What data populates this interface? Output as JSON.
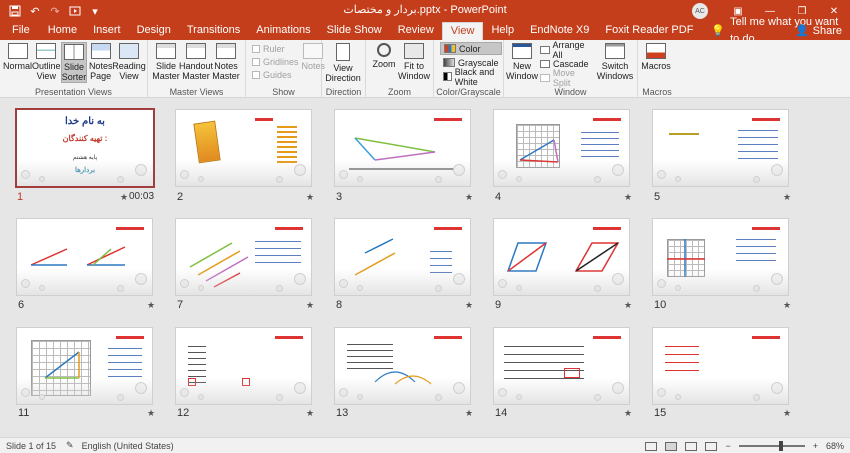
{
  "app": {
    "title": "بردار و مختصات.pptx - PowerPoint",
    "user_initials": "AC",
    "accent": "#c43e1c"
  },
  "qat": {
    "save_icon": "save-icon",
    "undo_icon": "undo-icon",
    "redo_icon": "redo-icon",
    "present_icon": "present-from-start-icon",
    "customize_icon": "customize-icon"
  },
  "window_controls": {
    "ribbon_options": "▣",
    "minimize": "—",
    "restore": "❐",
    "close": "✕"
  },
  "tabs": [
    {
      "label": "File"
    },
    {
      "label": "Home"
    },
    {
      "label": "Insert"
    },
    {
      "label": "Design"
    },
    {
      "label": "Transitions"
    },
    {
      "label": "Animations"
    },
    {
      "label": "Slide Show"
    },
    {
      "label": "Review"
    },
    {
      "label": "View"
    },
    {
      "label": "Help"
    },
    {
      "label": "EndNote X9"
    },
    {
      "label": "Foxit Reader PDF"
    }
  ],
  "active_tab": "View",
  "tellme": {
    "label": "Tell me what you want to do"
  },
  "share": {
    "label": "Share"
  },
  "ribbon": {
    "presentation_views": {
      "label": "Presentation Views",
      "buttons": [
        {
          "l1": "Normal",
          "l2": ""
        },
        {
          "l1": "Outline",
          "l2": "View"
        },
        {
          "l1": "Slide",
          "l2": "Sorter"
        },
        {
          "l1": "Notes",
          "l2": "Page"
        },
        {
          "l1": "Reading",
          "l2": "View"
        }
      ]
    },
    "master_views": {
      "label": "Master Views",
      "buttons": [
        {
          "l1": "Slide",
          "l2": "Master"
        },
        {
          "l1": "Handout",
          "l2": "Master"
        },
        {
          "l1": "Notes",
          "l2": "Master"
        }
      ]
    },
    "show": {
      "label": "Show",
      "items": [
        "Ruler",
        "Gridlines",
        "Guides"
      ],
      "notes": "Notes"
    },
    "direction": {
      "label": "Direction",
      "l1": "View",
      "l2": "Direction"
    },
    "zoom": {
      "label": "Zoom",
      "zoom": "Zoom",
      "fit_l1": "Fit to",
      "fit_l2": "Window"
    },
    "color_grayscale": {
      "label": "Color/Grayscale",
      "items": [
        "Color",
        "Grayscale",
        "Black and White"
      ]
    },
    "window": {
      "label": "Window",
      "new_l1": "New",
      "new_l2": "Window",
      "items": [
        "Arrange All",
        "Cascade",
        "Move Split"
      ],
      "switch_l1": "Switch",
      "switch_l2": "Windows"
    },
    "macros": {
      "label": "Macros",
      "button": "Macros"
    }
  },
  "slides": [
    {
      "num": "1",
      "timing": "00:03"
    },
    {
      "num": "2"
    },
    {
      "num": "3"
    },
    {
      "num": "4"
    },
    {
      "num": "5"
    },
    {
      "num": "6"
    },
    {
      "num": "7"
    },
    {
      "num": "8"
    },
    {
      "num": "9"
    },
    {
      "num": "10"
    },
    {
      "num": "11"
    },
    {
      "num": "12"
    },
    {
      "num": "13"
    },
    {
      "num": "14"
    },
    {
      "num": "15"
    }
  ],
  "slide1_content": {
    "title": "به نام خدا",
    "subtitle": "تهیه کنندگان :",
    "grade": "پایه هشتم",
    "topic": "بردارها"
  },
  "status": {
    "slide_info": "Slide 1 of 15",
    "language": "English (United States)",
    "zoom_minus": "−",
    "zoom_plus": "+",
    "zoom": "68%"
  }
}
